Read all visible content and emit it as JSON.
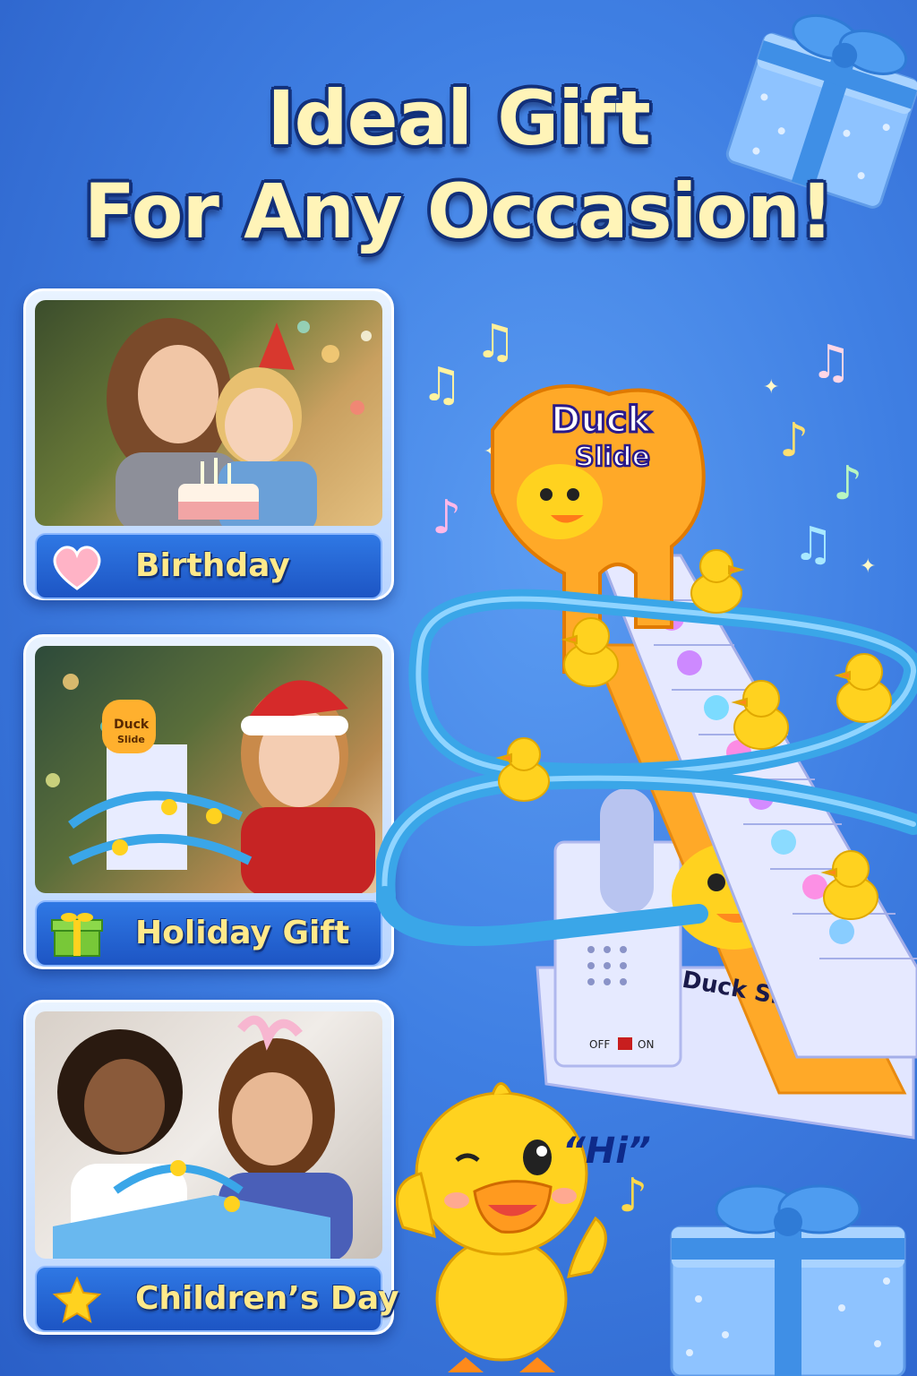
{
  "headline": {
    "line1": "Ideal Gift",
    "line2": "For Any Occasion!"
  },
  "occasions": [
    {
      "label": "Birthday",
      "icon": "heart-icon"
    },
    {
      "label": "Holiday Gift",
      "icon": "gift-icon"
    },
    {
      "label": "Children’s Day",
      "icon": "star-icon"
    }
  ],
  "toy": {
    "sign_line1": "Duck",
    "sign_line2": "Slide",
    "side_label": "Duck Slide",
    "switch_off": "OFF",
    "switch_on": "ON",
    "mini_sign_line1": "Duck",
    "mini_sign_line2": "Slide"
  },
  "mascot": {
    "speech": "“Hi”"
  },
  "colors": {
    "background": "#3f7fe3",
    "headline": "#fff4b8",
    "label_text": "#ffe98a",
    "track": "#3aa6e8",
    "duck": "#ffd21f",
    "sign": "#ffb02e"
  }
}
